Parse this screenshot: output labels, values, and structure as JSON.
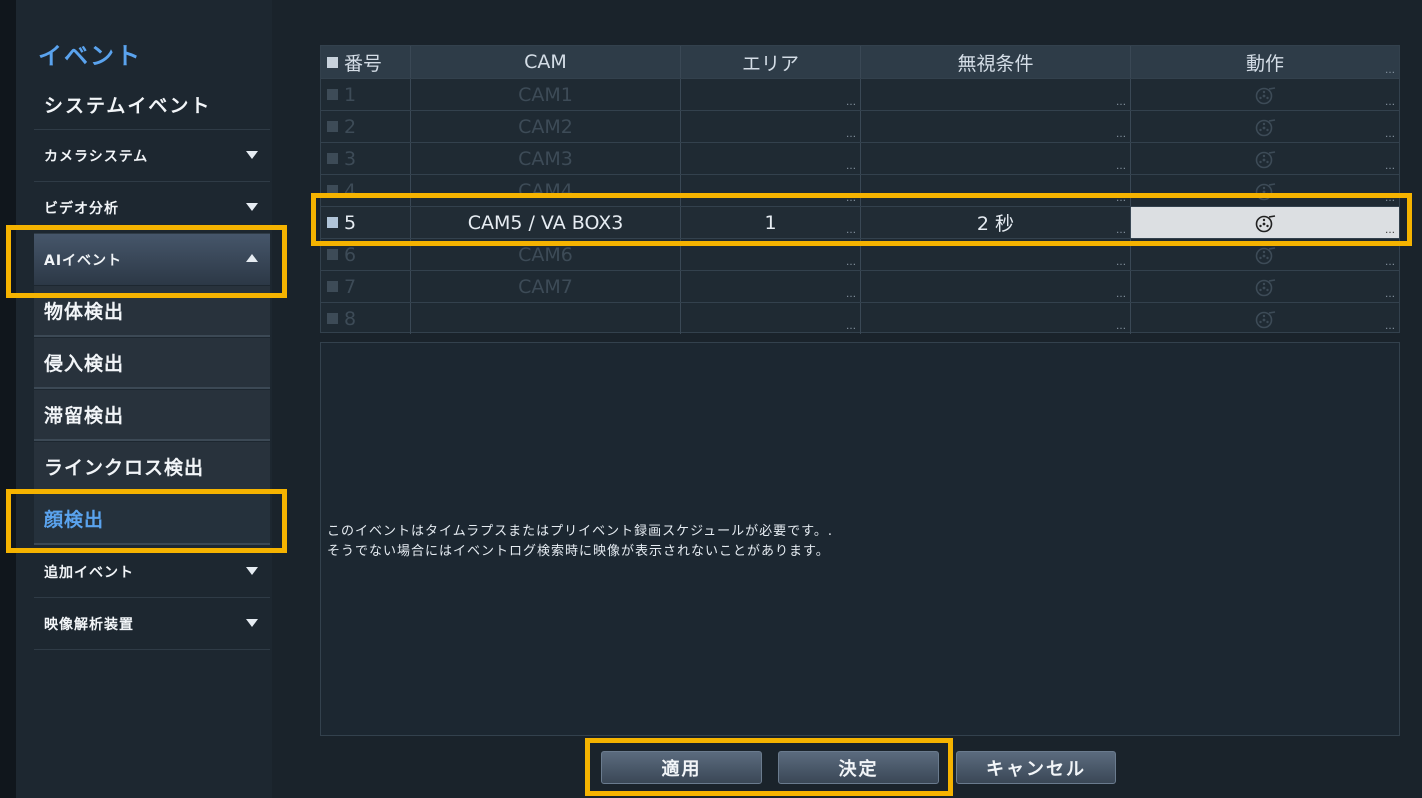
{
  "sidebar": {
    "title": "イベント",
    "items": [
      {
        "label": "システムイベント"
      },
      {
        "label": "カメラシステム"
      },
      {
        "label": "ビデオ分析"
      },
      {
        "label": "AIイベント"
      },
      {
        "label": "物体検出"
      },
      {
        "label": "侵入検出"
      },
      {
        "label": "滞留検出"
      },
      {
        "label": "ラインクロス検出"
      },
      {
        "label": "顔検出"
      },
      {
        "label": "追加イベント"
      },
      {
        "label": "映像解析装置"
      }
    ]
  },
  "table": {
    "headers": [
      "番号",
      "CAM",
      "エリア",
      "無視条件",
      "動作"
    ],
    "rows": [
      {
        "num": "1",
        "cam": "CAM1",
        "area": "",
        "ignore": ""
      },
      {
        "num": "2",
        "cam": "CAM2",
        "area": "",
        "ignore": ""
      },
      {
        "num": "3",
        "cam": "CAM3",
        "area": "",
        "ignore": ""
      },
      {
        "num": "4",
        "cam": "CAM4",
        "area": "",
        "ignore": ""
      },
      {
        "num": "5",
        "cam": "CAM5 / VA BOX3",
        "area": "1",
        "ignore": "2 秒"
      },
      {
        "num": "6",
        "cam": "CAM6",
        "area": "",
        "ignore": ""
      },
      {
        "num": "7",
        "cam": "CAM7",
        "area": "",
        "ignore": ""
      },
      {
        "num": "8",
        "cam": "",
        "area": "",
        "ignore": ""
      }
    ],
    "dots": "…",
    "action_icon": "reel-icon"
  },
  "notice": {
    "line1": "このイベントはタイムラプスまたはプリイベント録画スケジュールが必要です。.",
    "line2": "そうでない場合にはイベントログ検索時に映像が表示されないことがあります。"
  },
  "buttons": {
    "apply": "適用",
    "ok": "決定",
    "cancel": "キャンセル"
  },
  "colors": {
    "accent": "#5aa3ee",
    "highlight": "#f5b300"
  }
}
